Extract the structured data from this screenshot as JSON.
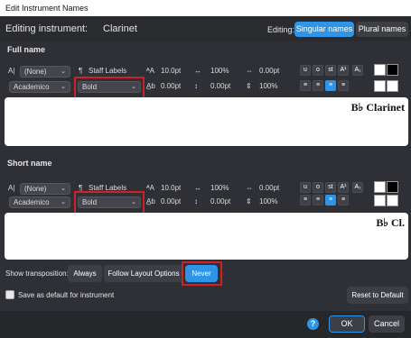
{
  "window": {
    "title": "Edit Instrument Names"
  },
  "header": {
    "editing_label": "Editing instrument:",
    "instrument": "Clarinet",
    "editing_mode_label": "Editing:",
    "singular": "Singular names",
    "plural": "Plural names"
  },
  "full": {
    "section": "Full name",
    "style": "(None)",
    "font_family": "Academico",
    "para_style": "Staff Labels",
    "font_style": "Bold",
    "size": "10.0pt",
    "h_scale": "100%",
    "tracking": "0.00pt",
    "baseline": "0.00pt",
    "line_spacing": "0.00pt",
    "v_scale": "100%",
    "v_offset": "0.00pt",
    "preview": "B♭ Clarinet"
  },
  "short": {
    "section": "Short name",
    "style": "(None)",
    "font_family": "Academico",
    "para_style": "Staff Labels",
    "font_style": "Bold",
    "size": "10.0pt",
    "h_scale": "100%",
    "tracking": "0.00pt",
    "baseline": "0.00pt",
    "line_spacing": "0.00pt",
    "v_scale": "100%",
    "v_offset": "0.00pt",
    "preview": "B♭ Cl."
  },
  "transposition": {
    "label": "Show transposition:",
    "options": [
      "Always",
      "Follow Layout Options",
      "Never"
    ],
    "selected": "Never"
  },
  "save_default": "Save as default for instrument",
  "reset": "Reset to Default",
  "ok": "OK",
  "cancel": "Cancel",
  "help": "?",
  "format_buttons": [
    "u",
    "o",
    "st",
    "A¹",
    "A₁"
  ],
  "colors": {
    "accent": "#2f94e6",
    "highlight": "#d0202a"
  }
}
